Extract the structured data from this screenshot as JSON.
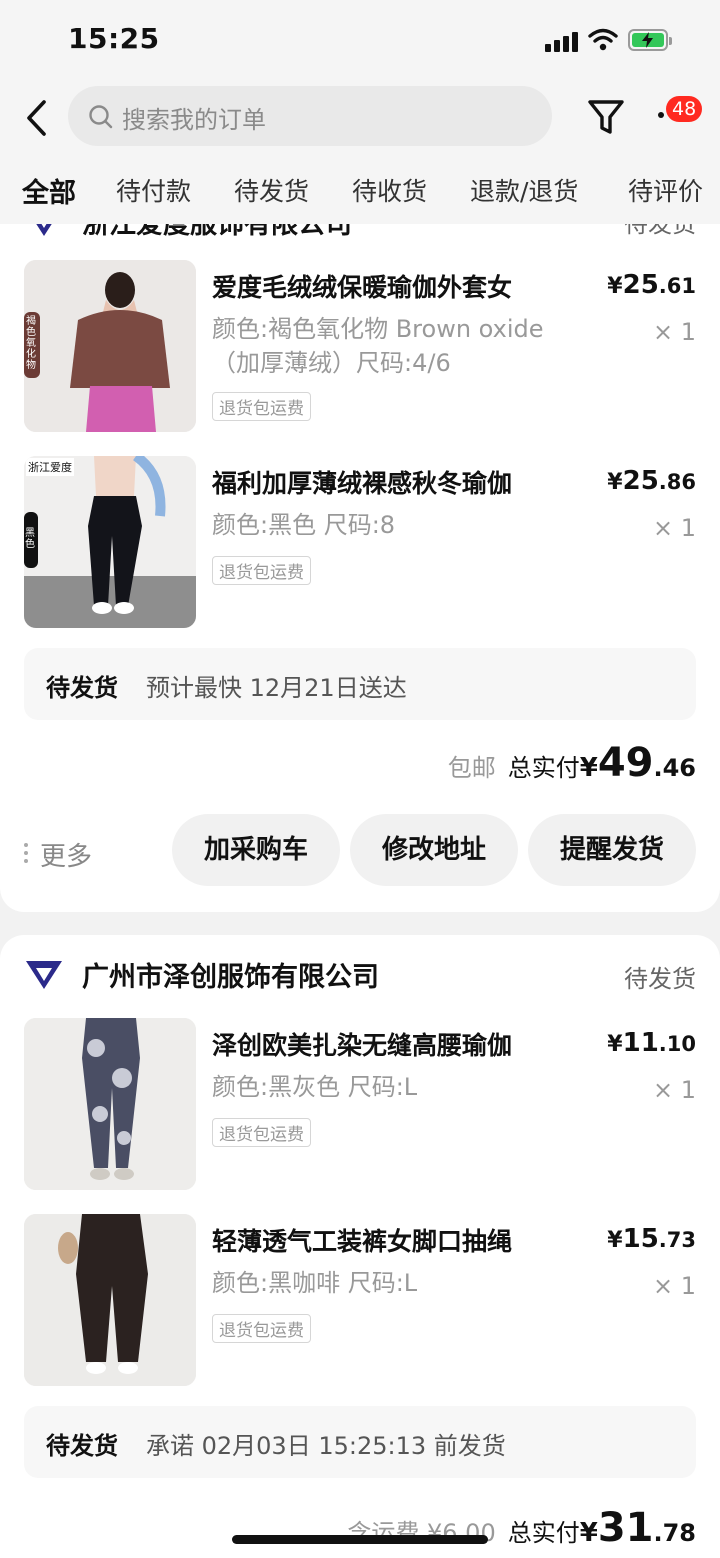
{
  "status_bar": {
    "time": "15:25"
  },
  "search": {
    "placeholder": "搜索我的订单"
  },
  "messages": {
    "badge": "48"
  },
  "tabs": [
    "全部",
    "待付款",
    "待发货",
    "待收货",
    "退款/退货",
    "待评价"
  ],
  "active_tab": "全部",
  "orders": [
    {
      "shop": "浙江爱度服饰有限公司",
      "status": "待发货",
      "items": [
        {
          "title": "爱度毛绒绒保暖瑜伽外套女",
          "spec": "颜色:褐色氧化物 Brown oxide（加厚薄绒）尺码:4/6",
          "tag": "退货包运费",
          "price_int": "25",
          "price_dec": ".61",
          "qty": "× 1",
          "thumb_label": "褐色氧化物"
        },
        {
          "title": "福利加厚薄绒裸感秋冬瑜伽",
          "spec": "颜色:黑色 尺码:8",
          "tag": "退货包运费",
          "price_int": "25",
          "price_dec": ".86",
          "qty": "× 1",
          "thumb_brand": "浙江爱度",
          "thumb_label": "黑色"
        }
      ],
      "shipping_status": "待发货",
      "shipping_desc": "预计最快 12月21日送达",
      "fee_note": "包邮",
      "total_label": "总实付",
      "total_int": "49",
      "total_dec": ".46",
      "more_label": "更多",
      "actions": [
        "加采购车",
        "修改地址",
        "提醒发货"
      ]
    },
    {
      "shop": "广州市泽创服饰有限公司",
      "status": "待发货",
      "items": [
        {
          "title": "泽创欧美扎染无缝高腰瑜伽",
          "spec": "颜色:黑灰色 尺码:L",
          "tag": "退货包运费",
          "price_int": "11",
          "price_dec": ".10",
          "qty": "× 1"
        },
        {
          "title": "轻薄透气工装裤女脚口抽绳",
          "spec": "颜色:黑咖啡 尺码:L",
          "tag": "退货包运费",
          "price_int": "15",
          "price_dec": ".73",
          "qty": "× 1"
        }
      ],
      "shipping_status": "待发货",
      "shipping_desc": "承诺 02月03日 15:25:13 前发货",
      "fee_note": "含运费 ¥6.00",
      "total_label": "总实付",
      "total_int": "31",
      "total_dec": ".78"
    }
  ],
  "currency": "¥",
  "colors": {
    "badge": "#ff2a20",
    "battery": "#33c759"
  }
}
